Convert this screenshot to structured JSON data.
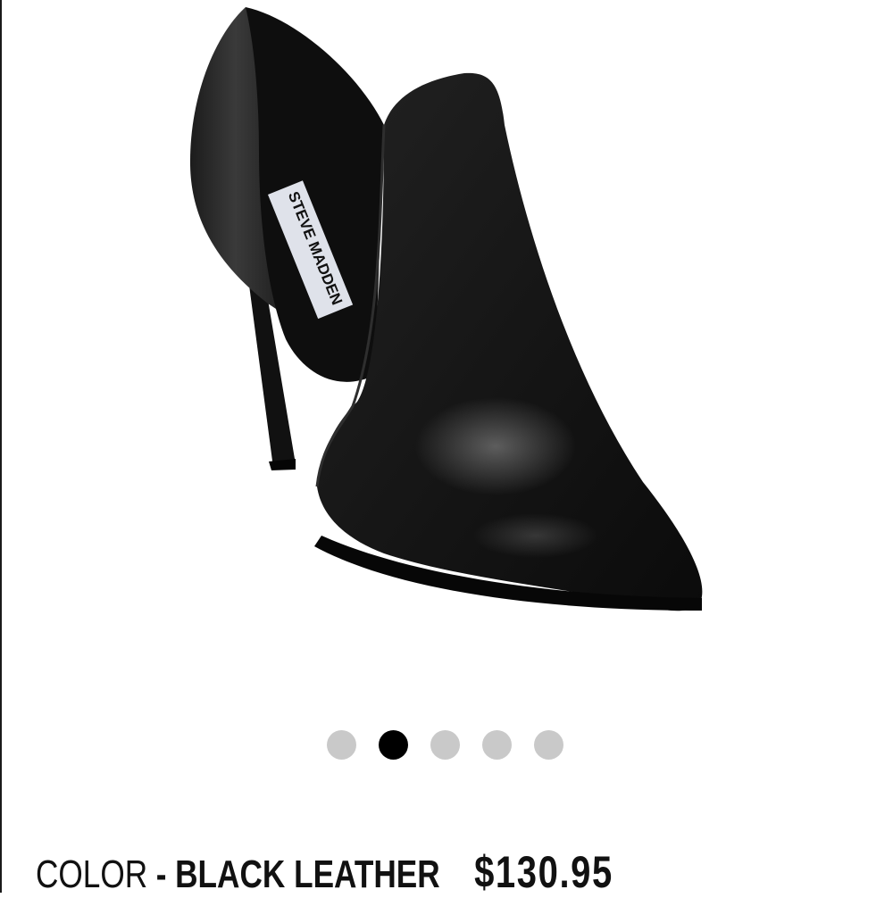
{
  "product": {
    "brand_label": "STEVE MADDEN",
    "color_prefix": "COLOR",
    "color_separator": "-",
    "color_value": "BLACK LEATHER",
    "price": "$130.95"
  },
  "carousel": {
    "total_slides": 5,
    "active_index": 1
  },
  "colors": {
    "dot_inactive": "#c9c9c9",
    "dot_active": "#000000",
    "text": "#111111"
  },
  "icons": {
    "product": "pointed-toe-stiletto-bootie"
  }
}
